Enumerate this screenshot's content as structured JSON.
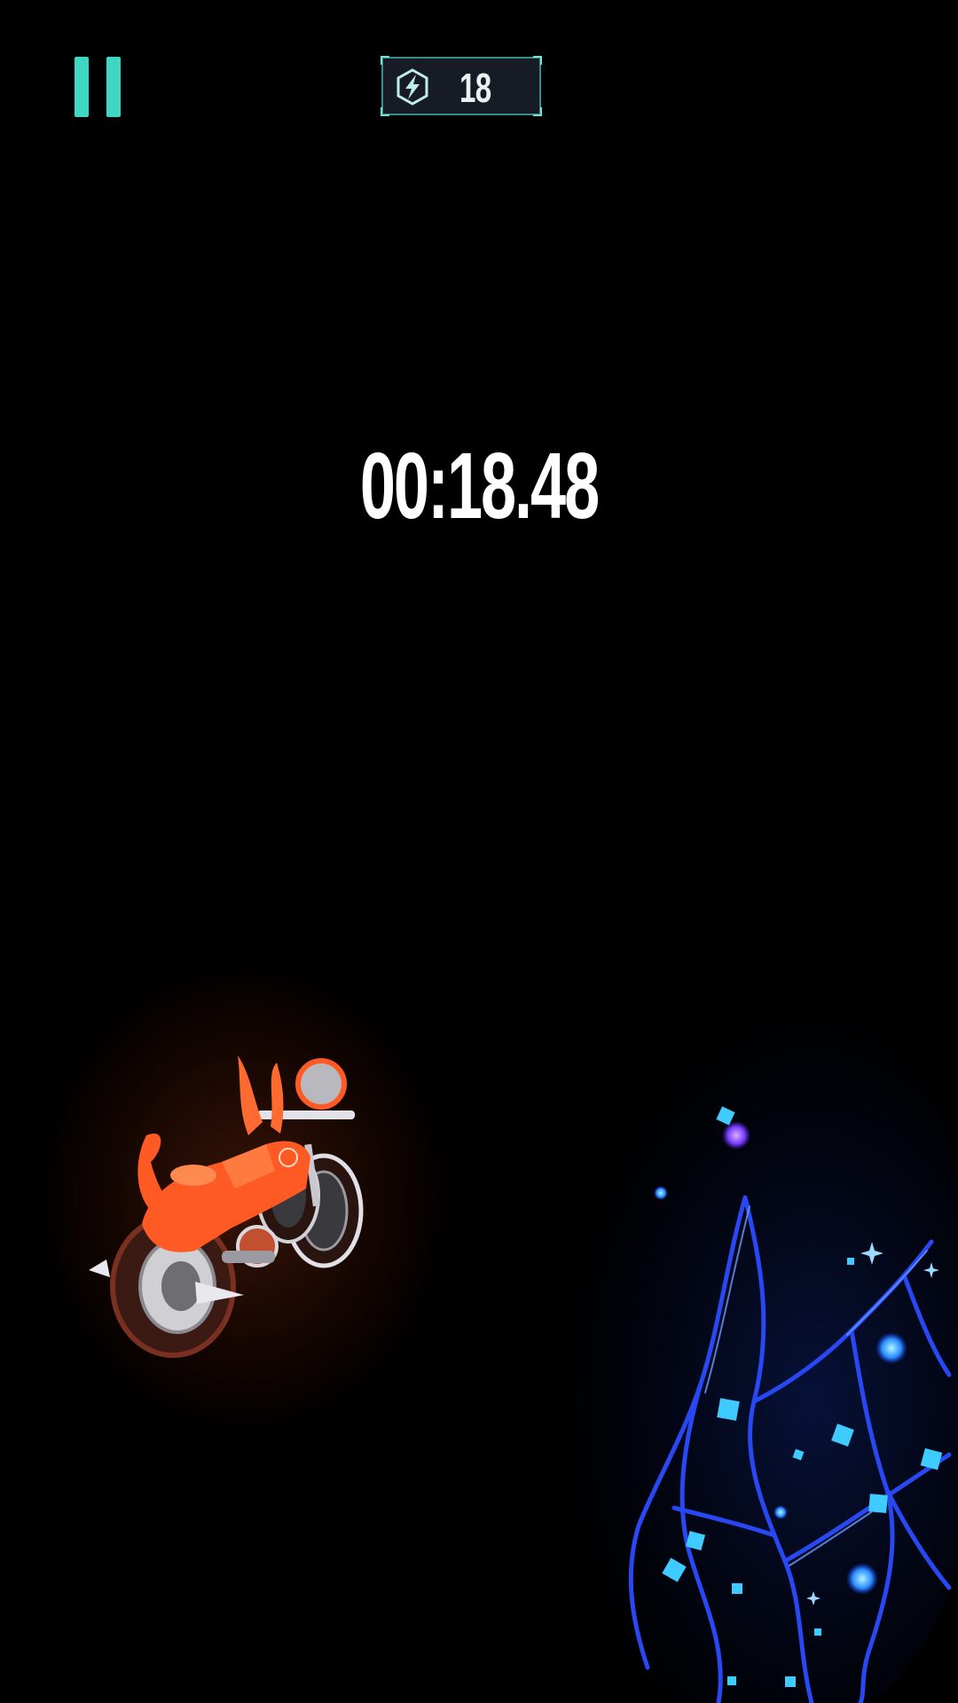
{
  "hud": {
    "pause_icon": "pause-icon",
    "energy_icon": "lightning-bolt-icon",
    "energy_count": "18",
    "timer": "00:18.48"
  },
  "colors": {
    "accent": "#3fd6c4",
    "bike": "#ff5a24",
    "crystal": "#2a5cff"
  }
}
